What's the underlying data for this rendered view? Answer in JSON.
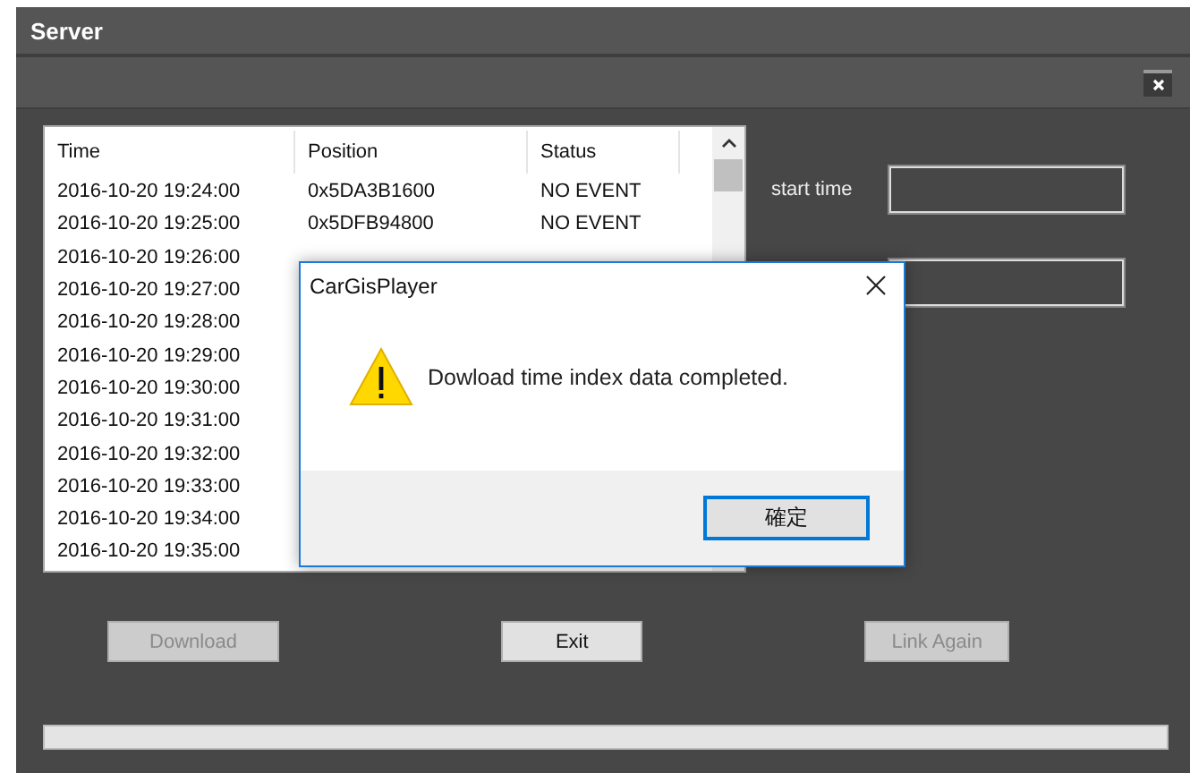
{
  "window": {
    "title": "Server"
  },
  "table": {
    "columns": [
      "Time",
      "Position",
      "Status"
    ],
    "rows": [
      {
        "time": "2016-10-20 19:24:00",
        "position": "0x5DA3B1600",
        "status": "NO EVENT"
      },
      {
        "time": "2016-10-20 19:25:00",
        "position": "0x5DFB94800",
        "status": "NO EVENT"
      },
      {
        "time": "2016-10-20 19:26:00"
      },
      {
        "time": "2016-10-20 19:27:00"
      },
      {
        "time": "2016-10-20 19:28:00"
      },
      {
        "time": "2016-10-20 19:29:00"
      },
      {
        "time": "2016-10-20 19:30:00"
      },
      {
        "time": "2016-10-20 19:31:00"
      },
      {
        "time": "2016-10-20 19:32:00"
      },
      {
        "time": "2016-10-20 19:33:00"
      },
      {
        "time": "2016-10-20 19:34:00"
      },
      {
        "time": "2016-10-20 19:35:00"
      }
    ]
  },
  "fields": [
    {
      "kind": "labeled",
      "label": "start time"
    },
    {
      "kind": "plain"
    }
  ],
  "progress": {
    "level": 0
  },
  "buttons": [
    {
      "label": "Download",
      "disabled": true
    },
    {
      "label": "Exit",
      "disabled": false
    },
    {
      "label": "Link Again",
      "disabled": true
    }
  ],
  "dialog": {
    "title": "CarGisPlayer",
    "message": "Dowload time index data completed.",
    "button": "確定"
  }
}
